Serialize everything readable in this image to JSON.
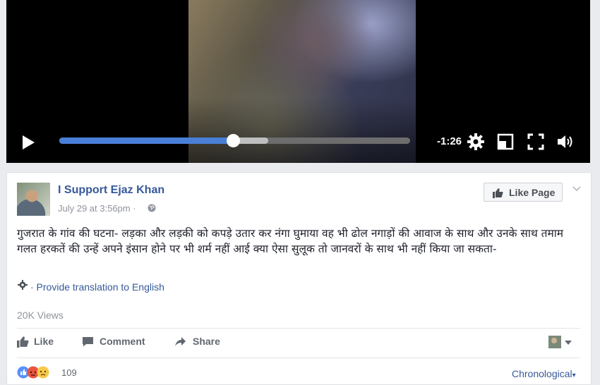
{
  "video": {
    "time_remaining": "-1:26",
    "progress": 0.497,
    "buffered": 0.596
  },
  "post": {
    "page_name": "I Support Ejaz Khan",
    "date": "July 29 at 3:56pm ·",
    "like_page_label": "Like Page",
    "text": "गुजरात के गांव की घटना- लड़का और लड़की को कपड़े उतार कर नंगा घुमाया वह भी ढोल नगाड़ों की आवाज के साथ और उनके साथ तमाम गलत हरकतें की उन्हें अपने इंसान होने पर भी शर्म नहीं आई क्या ऐसा सुलूक तो जानवरों के साथ भी नहीं किया जा सकता-",
    "translate_link": "· Provide translation to English",
    "views": "20K Views",
    "actions": {
      "like": "Like",
      "comment": "Comment",
      "share": "Share"
    },
    "reaction_count": "109",
    "sort_label": "Chronological"
  },
  "colors": {
    "link": "#365899",
    "progress_fill": "#4a7fd8",
    "video_bg": "#000000"
  }
}
